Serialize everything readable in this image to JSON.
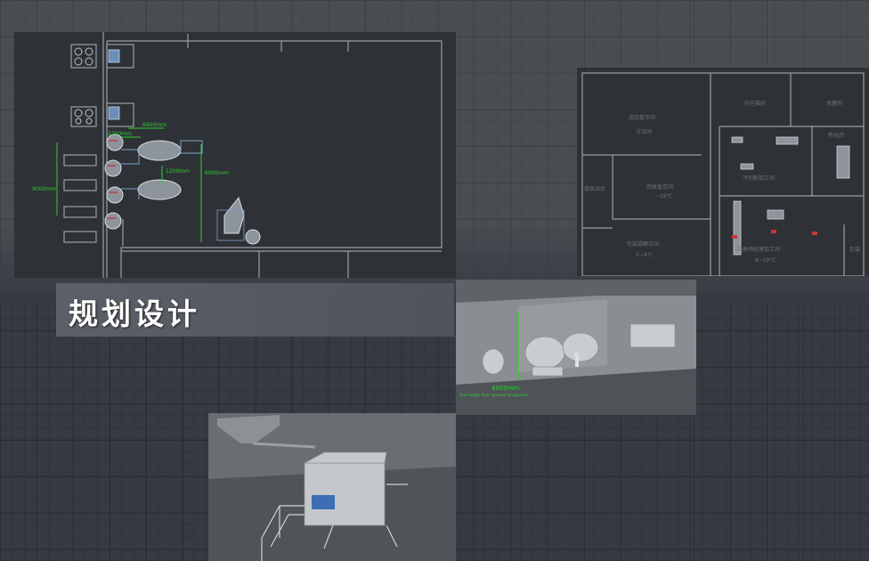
{
  "banner": {
    "title": "规划设计"
  },
  "plan_left": {
    "dim_6600": "6600mm",
    "dim_2700": "2700mm",
    "dim_1200": "1200mm",
    "dim_6000": "6000mm",
    "dim_9000": "9000mm"
  },
  "plan_right": {
    "room_finished_storage": "成品暂存间",
    "room_cold_storage": "冷冻间",
    "room_inner_pack": "内包装间",
    "room_seasoning": "杀菌间",
    "room_cooking": "熟化间",
    "room_meat_temp_storage": "肉类暂存间",
    "room_meat_temp_value": "~18℃",
    "room_freeze_cut": "冷切割加工间",
    "room_receiving": "接收站台",
    "room_pack_thaw": "包装袋解冻间",
    "room_pack_thaw_value": "0~4℃",
    "room_meat_process": "肉类预处理加工间",
    "room_meat_process_value": "8~10℃",
    "room_edge": "包装"
  },
  "render_right": {
    "dim_4000": "4000mm",
    "caption": "the height from ground to pipeline"
  },
  "colors": {
    "dimension_green": "#2fd12f",
    "plan_line": "#9aa0a6",
    "banner_bg": "#565a63"
  }
}
